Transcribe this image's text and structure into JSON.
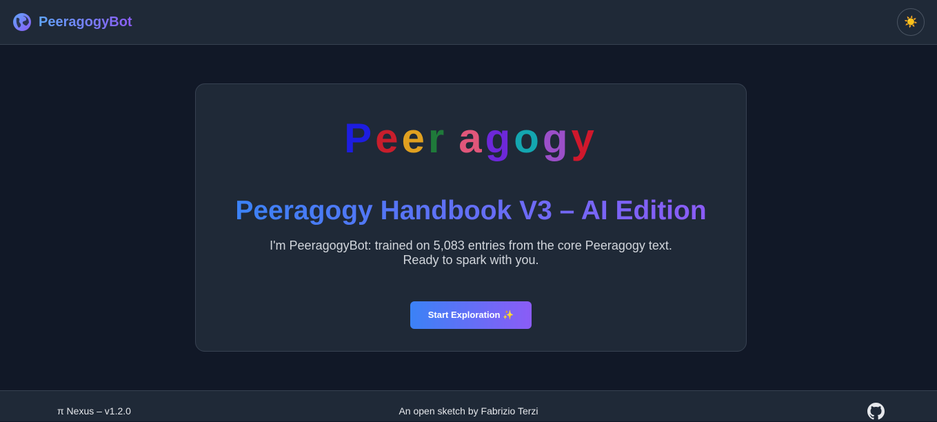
{
  "header": {
    "brand_name": "PeeragogyBot",
    "brand_icon": "globe-icon",
    "theme_toggle_icon": "sun-icon",
    "theme_toggle_glyph": "☀️"
  },
  "hero": {
    "logo_letters": [
      {
        "char": "P",
        "color": "#1d1de0"
      },
      {
        "char": "e",
        "color": "#c81e2c"
      },
      {
        "char": "e",
        "color": "#e0a020"
      },
      {
        "char": "r",
        "color": "#1f7a3a"
      },
      {
        "char": "a",
        "color": "#e0567a"
      },
      {
        "char": "g",
        "color": "#6d28d9"
      },
      {
        "char": "o",
        "color": "#14a6b0"
      },
      {
        "char": "g",
        "color": "#9b4fc8"
      },
      {
        "char": "y",
        "color": "#d0182c"
      }
    ],
    "title": "Peeragogy Handbook V3 – AI Edition",
    "subtitle": "I'm PeeragogyBot: trained on 5,083 entries from the core Peeragogy text. Ready to spark with you.",
    "cta_label": "Start Exploration ✨"
  },
  "footer": {
    "left_text": "π Nexus – v1.2.0",
    "center_text": "An open sketch by Fabrizio Terzi",
    "right_icon": "github-icon"
  },
  "colors": {
    "background": "#111827",
    "surface": "#1f2937",
    "gradient_start": "#3b82f6",
    "gradient_end": "#8b5cf6"
  }
}
